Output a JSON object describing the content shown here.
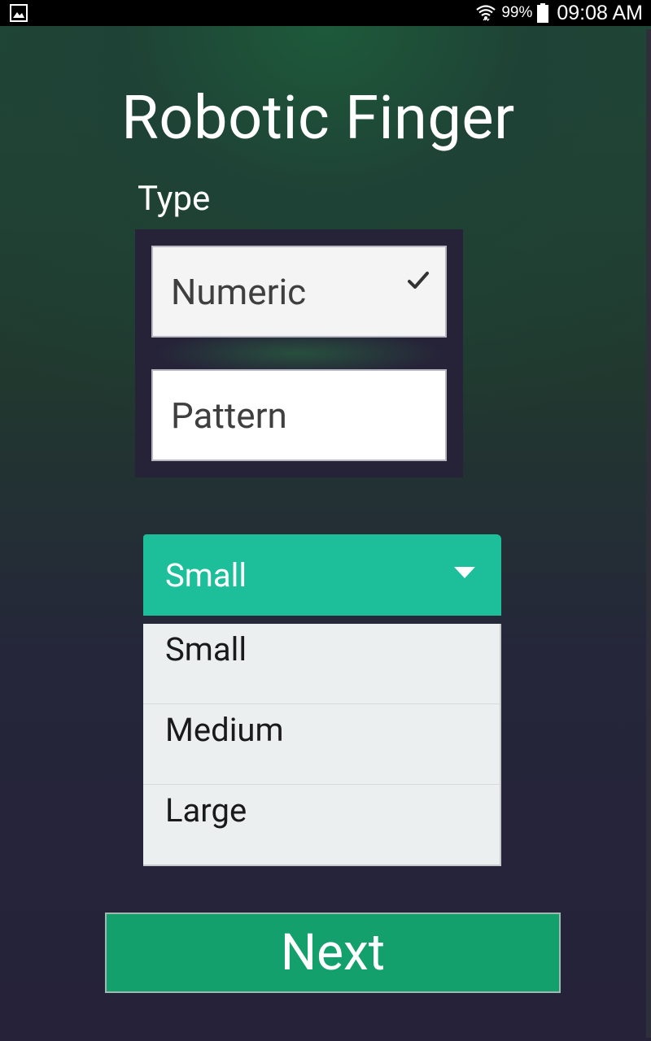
{
  "status_bar": {
    "left_icon": "gallery-icon",
    "wifi_icon": "wifi-icon",
    "battery_percent": "99%",
    "battery_icon": "battery-icon",
    "time": "09:08 AM"
  },
  "app": {
    "title": "Robotic Finger",
    "type_label": "Type",
    "type_options": [
      {
        "label": "Numeric",
        "selected": true,
        "icon": "check-icon"
      },
      {
        "label": "Pattern",
        "selected": false
      }
    ],
    "size_select": {
      "selected": "Small",
      "icon": "caret-down-icon",
      "options": [
        "Small",
        "Medium",
        "Large"
      ]
    },
    "next_label": "Next"
  },
  "colors": {
    "accent_select": "#1dbf9a",
    "next_button": "#13a06c",
    "panel": "#262238",
    "background_top": "#1f4a35",
    "background_bottom": "#25223a"
  }
}
